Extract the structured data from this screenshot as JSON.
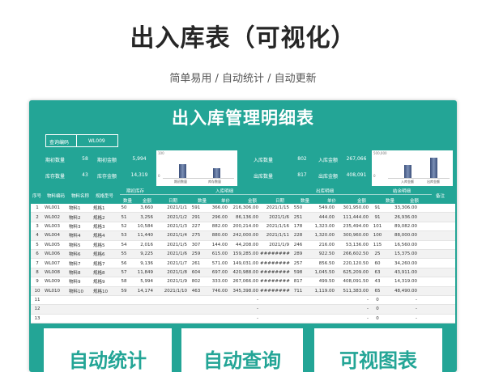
{
  "poster": {
    "title": "出入库表（可视化）",
    "subtitle": "简单易用  /  自动统计  /  自动更新"
  },
  "sheet": {
    "title": "出入库管理明细表",
    "query_label": "查询编码",
    "query_value": "WL009",
    "summary": {
      "initial_qty_label": "期初数量",
      "initial_qty": "58",
      "initial_amt_label": "期初金额",
      "initial_amt": "5,994",
      "stock_qty_label": "库存数量",
      "stock_qty": "43",
      "stock_amt_label": "库存金额",
      "stock_amt": "14,319",
      "in_qty_label": "入库数量",
      "in_qty": "802",
      "in_amt_label": "入库金额",
      "in_amt": "267,066",
      "out_qty_label": "出库数量",
      "out_qty": "817",
      "out_amt_label": "出库金额",
      "out_amt": "408,091"
    },
    "mini_chart_1": {
      "ytick": "100",
      "ytick0": "0",
      "labels": [
        "期初数量",
        "库存数量"
      ]
    },
    "mini_chart_2": {
      "ytick": "500,000",
      "ytick0": "0",
      "labels": [
        "入库金额",
        "出库金额"
      ]
    },
    "headers": {
      "seq": "序号",
      "code": "物料编码",
      "name": "物料名称",
      "spec": "规格型号",
      "initial_group": "期初库存",
      "in_group": "入库明细",
      "out_group": "出库明细",
      "stock_group": "结余明细",
      "note": "备注",
      "qty": "数量",
      "amt": "金额",
      "date": "日期",
      "price": "单价"
    },
    "rows": [
      [
        "1",
        "WL001",
        "物料1",
        "规格1",
        "50",
        "3,660",
        "2021/1/1",
        "591",
        "366.00",
        "216,306.00",
        "2021/1/15",
        "550",
        "549.00",
        "301,950.00",
        "91",
        "33,306.00"
      ],
      [
        "2",
        "WL002",
        "物料2",
        "规格2",
        "51",
        "3,256",
        "2021/1/2",
        "291",
        "296.00",
        "86,136.00",
        "2021/1/6",
        "251",
        "444.00",
        "111,444.00",
        "91",
        "26,936.00"
      ],
      [
        "3",
        "WL003",
        "物料3",
        "规格3",
        "52",
        "10,584",
        "2021/1/3",
        "227",
        "882.00",
        "200,214.00",
        "2021/1/16",
        "178",
        "1,323.00",
        "235,494.00",
        "101",
        "89,082.00"
      ],
      [
        "4",
        "WL004",
        "物料4",
        "规格4",
        "53",
        "11,440",
        "2021/1/4",
        "275",
        "880.00",
        "242,000.00",
        "2021/1/11",
        "228",
        "1,320.00",
        "300,960.00",
        "100",
        "88,000.00"
      ],
      [
        "5",
        "WL005",
        "物料5",
        "规格5",
        "54",
        "2,016",
        "2021/1/5",
        "307",
        "144.00",
        "44,208.00",
        "2021/1/9",
        "246",
        "216.00",
        "53,136.00",
        "115",
        "16,560.00"
      ],
      [
        "6",
        "WL006",
        "物料6",
        "规格6",
        "55",
        "9,225",
        "2021/1/6",
        "259",
        "615.00",
        "159,285.00",
        "########",
        "289",
        "922.50",
        "266,602.50",
        "25",
        "15,375.00"
      ],
      [
        "7",
        "WL007",
        "物料7",
        "规格7",
        "56",
        "9,136",
        "2021/1/7",
        "261",
        "571.00",
        "149,031.00",
        "########",
        "257",
        "856.50",
        "220,120.50",
        "60",
        "34,260.00"
      ],
      [
        "8",
        "WL008",
        "物料8",
        "规格8",
        "57",
        "11,849",
        "2021/1/8",
        "604",
        "697.00",
        "420,988.00",
        "########",
        "598",
        "1,045.50",
        "625,209.00",
        "63",
        "43,911.00"
      ],
      [
        "9",
        "WL009",
        "物料9",
        "规格9",
        "58",
        "5,994",
        "2021/1/9",
        "802",
        "333.00",
        "267,066.00",
        "########",
        "817",
        "499.50",
        "408,091.50",
        "43",
        "14,319.00"
      ],
      [
        "10",
        "WL010",
        "物料10",
        "规格10",
        "59",
        "14,174",
        "2021/1/10",
        "463",
        "746.00",
        "345,398.00",
        "########",
        "711",
        "1,119.00",
        "511,383.00",
        "65",
        "48,490.00"
      ],
      [
        "11",
        "",
        "",
        "",
        "",
        "",
        "",
        "",
        "",
        "-",
        "",
        "",
        "",
        "-",
        "0",
        "-"
      ],
      [
        "12",
        "",
        "",
        "",
        "",
        "",
        "",
        "",
        "",
        "-",
        "",
        "",
        "",
        "-",
        "0",
        "-"
      ],
      [
        "13",
        "",
        "",
        "",
        "",
        "",
        "",
        "",
        "",
        "-",
        "",
        "",
        "",
        "-",
        "0",
        "-"
      ]
    ],
    "bottom_buttons": [
      "自动统计",
      "自动查询",
      "可视图表"
    ]
  },
  "colors": {
    "accent": "#23a596",
    "bar": "#4b5f8a"
  }
}
